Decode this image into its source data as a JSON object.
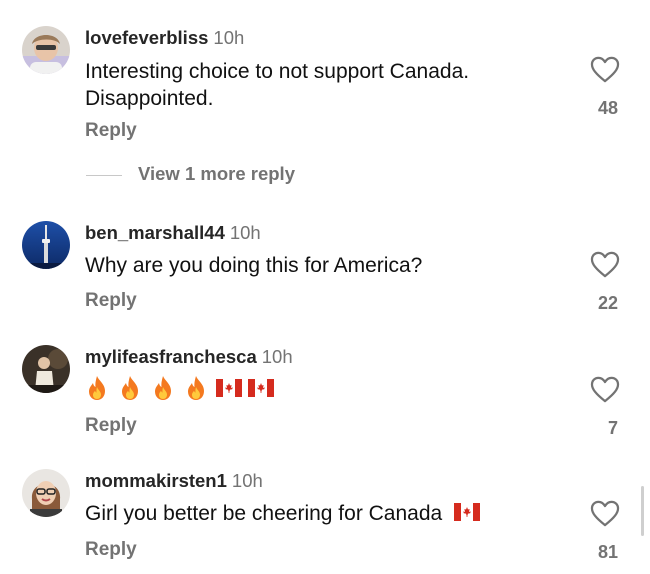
{
  "comments": [
    {
      "username": "lovefeverbliss",
      "time": "10h",
      "text": "Interesting choice to not support Canada. Disappointed.",
      "reply_label": "Reply",
      "likes": "48"
    },
    {
      "username": "ben_marshall44",
      "time": "10h",
      "text": "Why are you doing this for America?",
      "reply_label": "Reply",
      "likes": "22"
    },
    {
      "username": "mylifeasfranchesca",
      "time": "10h",
      "text": "🔥🔥🔥🔥🇨🇦🇨🇦",
      "reply_label": "Reply",
      "likes": "7"
    },
    {
      "username": "mommakirsten1",
      "time": "10h",
      "text": "Girl you better be cheering for Canada",
      "reply_label": "Reply",
      "likes": "81"
    }
  ],
  "view_more_label": "View 1 more reply",
  "icons": {
    "like": "heart-icon",
    "fire": "fire-icon",
    "flag": "canada-flag-icon"
  },
  "colors": {
    "secondary_text": "#737373",
    "flag_red": "#d52b1e"
  }
}
